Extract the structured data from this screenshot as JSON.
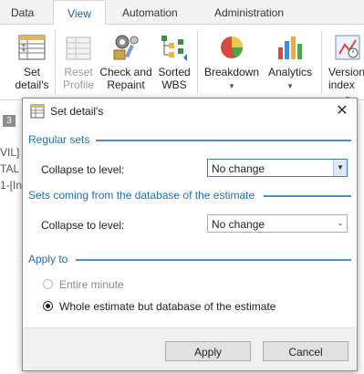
{
  "ribbon": {
    "tabs": [
      {
        "label": "Data",
        "active": false
      },
      {
        "label": "View",
        "active": true
      },
      {
        "label": "Automation",
        "active": false
      },
      {
        "label": "Administration",
        "active": false
      }
    ],
    "buttons": {
      "set_details": "Set detail's",
      "reset_profile": "Reset Profile",
      "check_repaint": "Check and Repaint",
      "sorted_wbs": "Sorted WBS",
      "breakdown": "Breakdown",
      "analytics": "Analytics",
      "version_index": "Version index"
    }
  },
  "background": {
    "tab_number": "3",
    "line1": "VIL]",
    "line2": "TAL",
    "line3": "1-[In"
  },
  "dialog": {
    "title": "Set detail's",
    "sections": {
      "regular": "Regular sets",
      "database": "Sets coming from the database of the estimate",
      "apply_to": "Apply to"
    },
    "regular_collapse_label": "Collapse to level:",
    "regular_collapse_value": "No change",
    "database_collapse_label": "Collapse to level:",
    "database_collapse_value": "No change",
    "radio_entire_minute": "Entire minute",
    "radio_whole_estimate": "Whole estimate but database of the estimate",
    "selected_radio": "whole_estimate",
    "apply_label": "Apply",
    "cancel_label": "Cancel"
  },
  "colors": {
    "accent": "#1f6fb5",
    "section_line": "#4a8cc7",
    "dialog_footer": "#f0f0f0"
  }
}
